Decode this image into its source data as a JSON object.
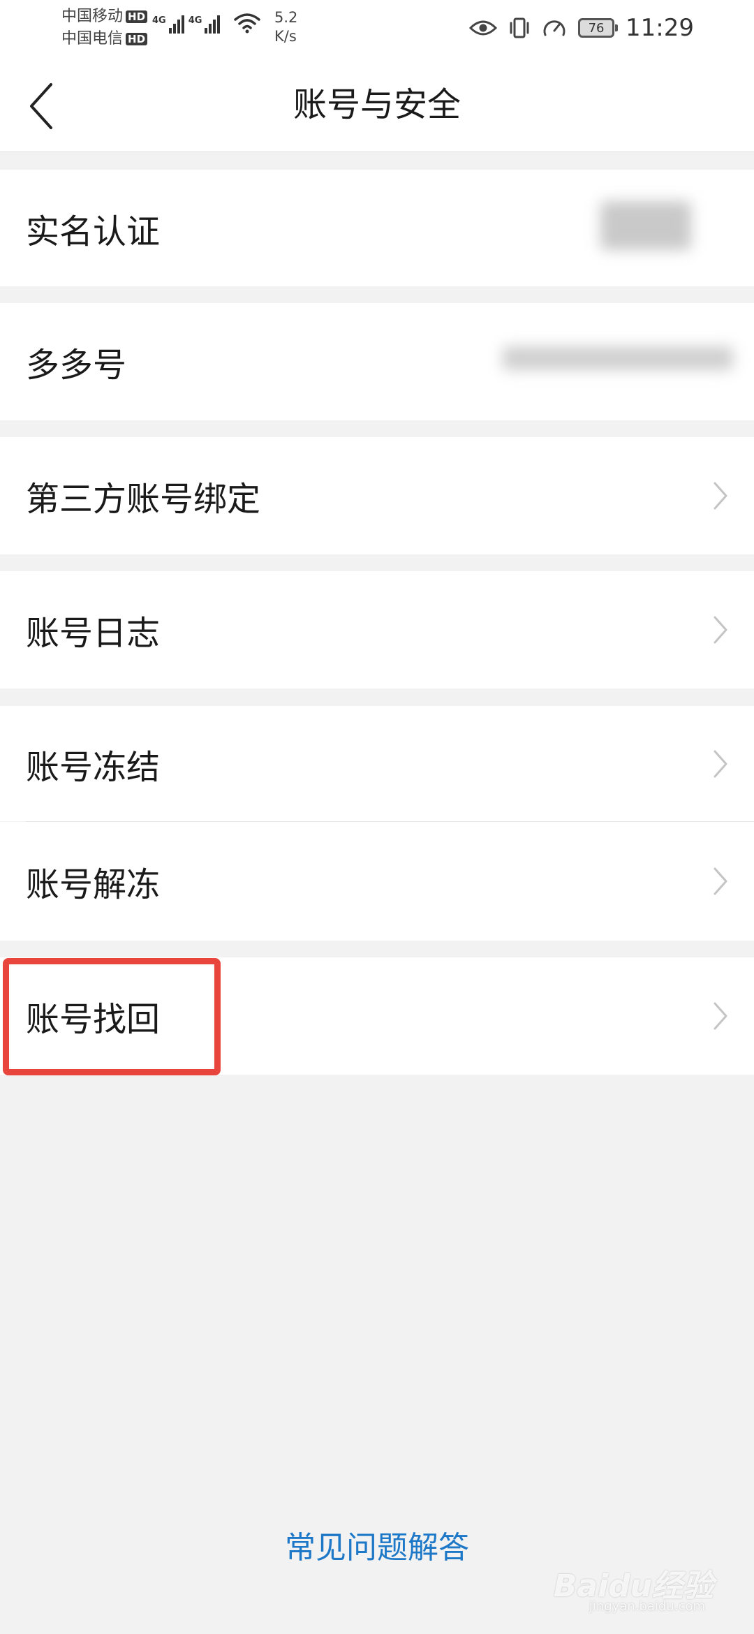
{
  "status_bar": {
    "carrier_1": "中国移动",
    "carrier_2": "中国电信",
    "hd_badge": "HD",
    "network_type": "4G",
    "net_speed_value": "5.2",
    "net_speed_unit": "K/s",
    "battery_level": "76",
    "time": "11:29"
  },
  "header": {
    "title": "账号与安全"
  },
  "menu": {
    "items": [
      {
        "label": "实名认证"
      },
      {
        "label": "多多号"
      },
      {
        "label": "第三方账号绑定"
      },
      {
        "label": "账号日志"
      },
      {
        "label": "账号冻结"
      },
      {
        "label": "账号解冻"
      },
      {
        "label": "账号找回"
      }
    ]
  },
  "footer": {
    "faq_link": "常见问题解答"
  },
  "watermark": {
    "brand": "Baidu经验",
    "domain": "jingyan.baidu.com"
  },
  "colors": {
    "background": "#f2f2f2",
    "highlight": "#e8463c",
    "link": "#1e78c8"
  }
}
